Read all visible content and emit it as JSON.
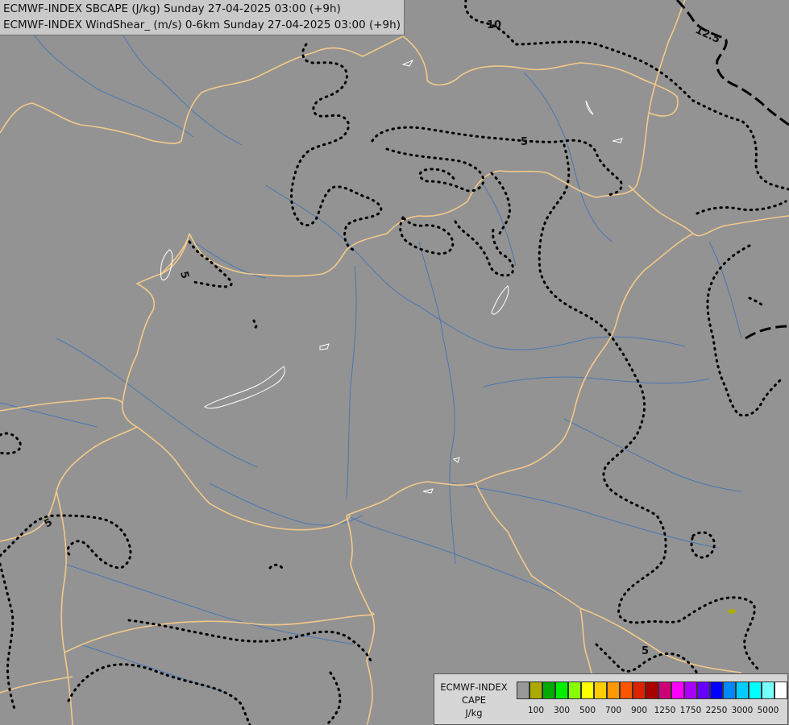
{
  "header": {
    "line1": "ECMWF-INDEX SBCAPE (J/kg) Sunday 27-04-2025 03:00 (+9h)",
    "line2": "ECMWF-INDEX WindShear_ (m/s) 0-6km Sunday 27-04-2025 03:00 (+9h)"
  },
  "contour_labels": [
    "10",
    "12.5",
    "5",
    "5",
    "5",
    "5"
  ],
  "legend": {
    "title_lines": [
      "ECMWF-INDEX",
      "CAPE",
      "J/kg"
    ],
    "colors": [
      "#999999",
      "#aaaa00",
      "#00aa00",
      "#00ee00",
      "#88ff00",
      "#ffff00",
      "#ffcc00",
      "#ff9900",
      "#ff5500",
      "#dd2200",
      "#aa0000",
      "#cc0077",
      "#ff00ff",
      "#aa00ff",
      "#6600ff",
      "#0000ff",
      "#0088ff",
      "#00ccff",
      "#00ffff",
      "#77ffff",
      "#ffffff"
    ],
    "tick_labels": [
      "100",
      "300",
      "500",
      "700",
      "900",
      "1250",
      "1750",
      "2250",
      "3000",
      "5000"
    ]
  },
  "map_colors": {
    "background": "#939393",
    "borders": "#f2c98a",
    "rivers": "#4a78b0",
    "lakes": "#ffffff",
    "contours": "#000000"
  }
}
